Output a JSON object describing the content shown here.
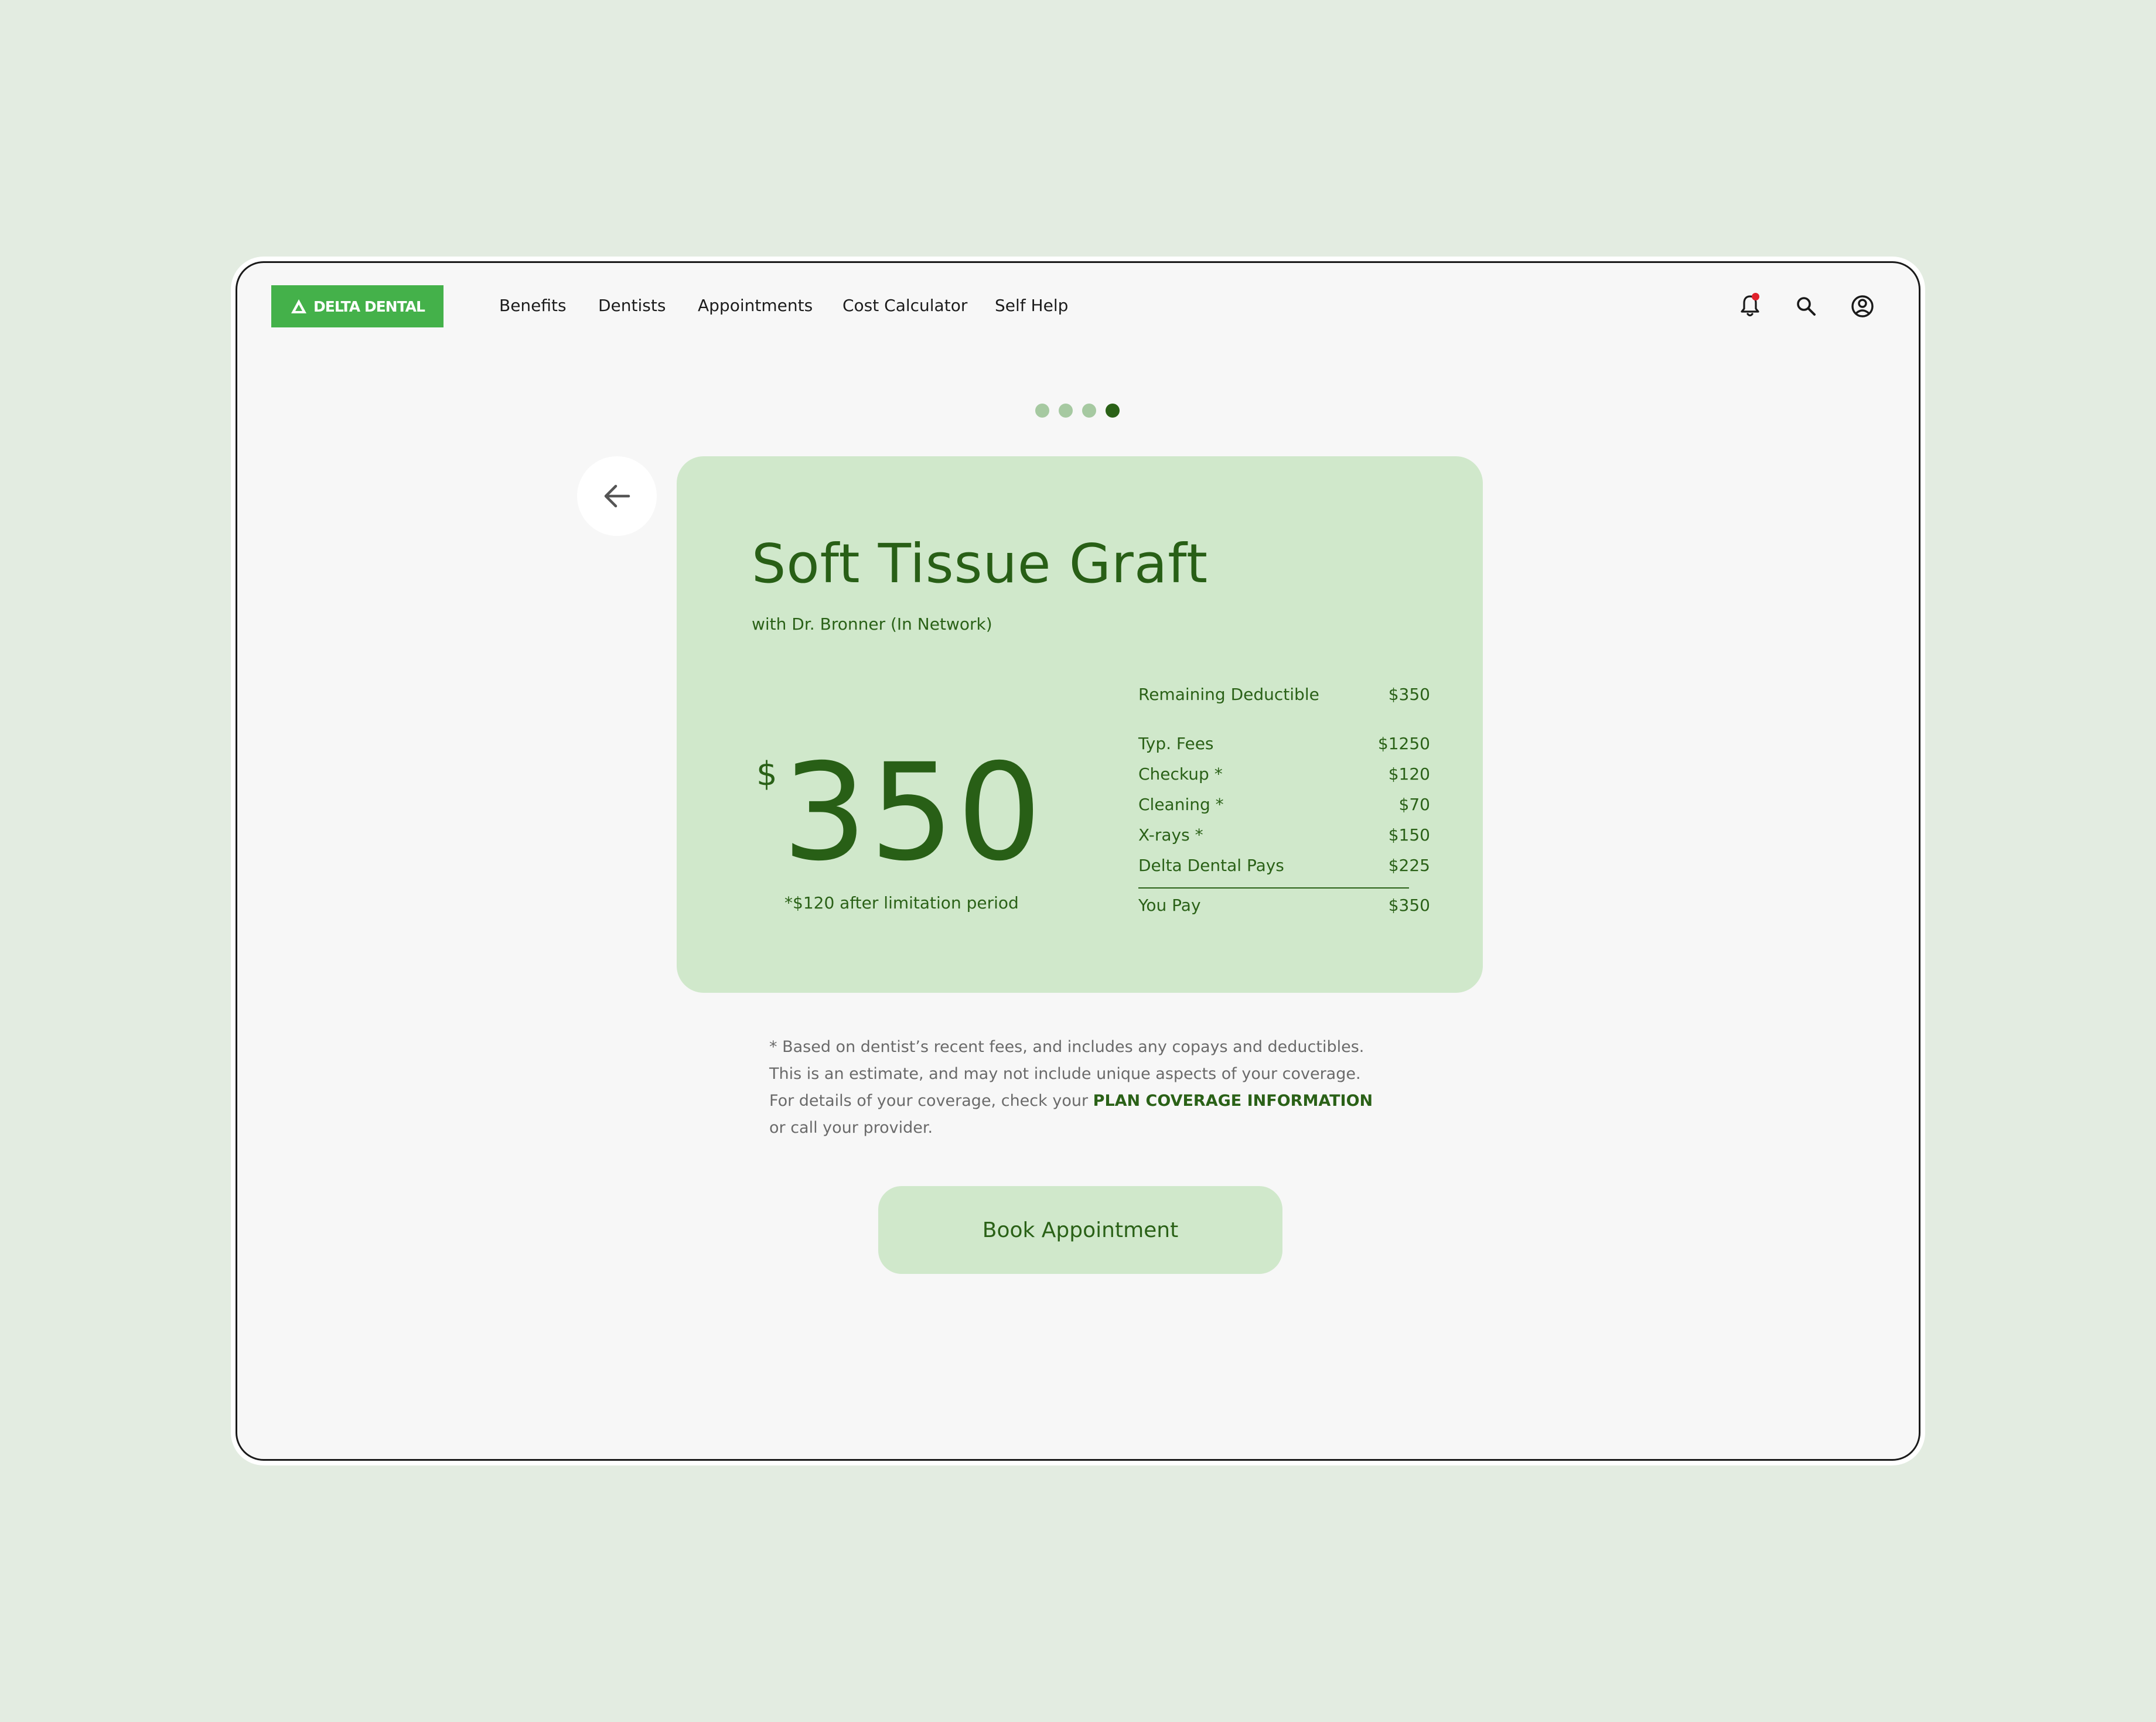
{
  "brand": {
    "logo_text": "DELTA DENTAL",
    "color": "#44b14a"
  },
  "nav": {
    "items": [
      "Benefits",
      "Dentists",
      "Appointments",
      "Cost Calculator",
      "Self Help"
    ]
  },
  "header_icons": [
    "bell-icon",
    "search-icon",
    "account-icon"
  ],
  "pager": {
    "total": 4,
    "active": 4
  },
  "procedure": {
    "title": "Soft Tissue Graft",
    "subtitle": "with Dr. Bronner (In Network)",
    "currency_symbol": "$",
    "price": "350",
    "price_note": "*$120 after limitation period"
  },
  "fees": {
    "remaining_deductible": {
      "label": "Remaining Deductible",
      "value": "$350"
    },
    "rows": [
      {
        "label": "Typ. Fees",
        "value": "$1250"
      },
      {
        "label": "Checkup *",
        "value": "$120"
      },
      {
        "label": "Cleaning *",
        "value": "$70"
      },
      {
        "label": "X-rays *",
        "value": "$150"
      },
      {
        "label": "Delta Dental Pays",
        "value": "$225"
      }
    ],
    "total": {
      "label": "You Pay",
      "value": "$350"
    }
  },
  "disclaimer": {
    "text_before": "* Based on dentist’s recent fees, and includes any copays and deductibles. This is an estimate, and may not include unique aspects of your coverage. For details of your coverage, check your ",
    "link": "PLAN COVERAGE INFORMATION",
    "text_after": " or call your provider."
  },
  "actions": {
    "book_label": "Book Appointment"
  },
  "colors": {
    "page_bg": "#e3ece1",
    "window_bg": "#f7f7f7",
    "card_bg": "#d0e8cb",
    "accent_dark": "#2a6117",
    "notification": "#e0212b"
  }
}
